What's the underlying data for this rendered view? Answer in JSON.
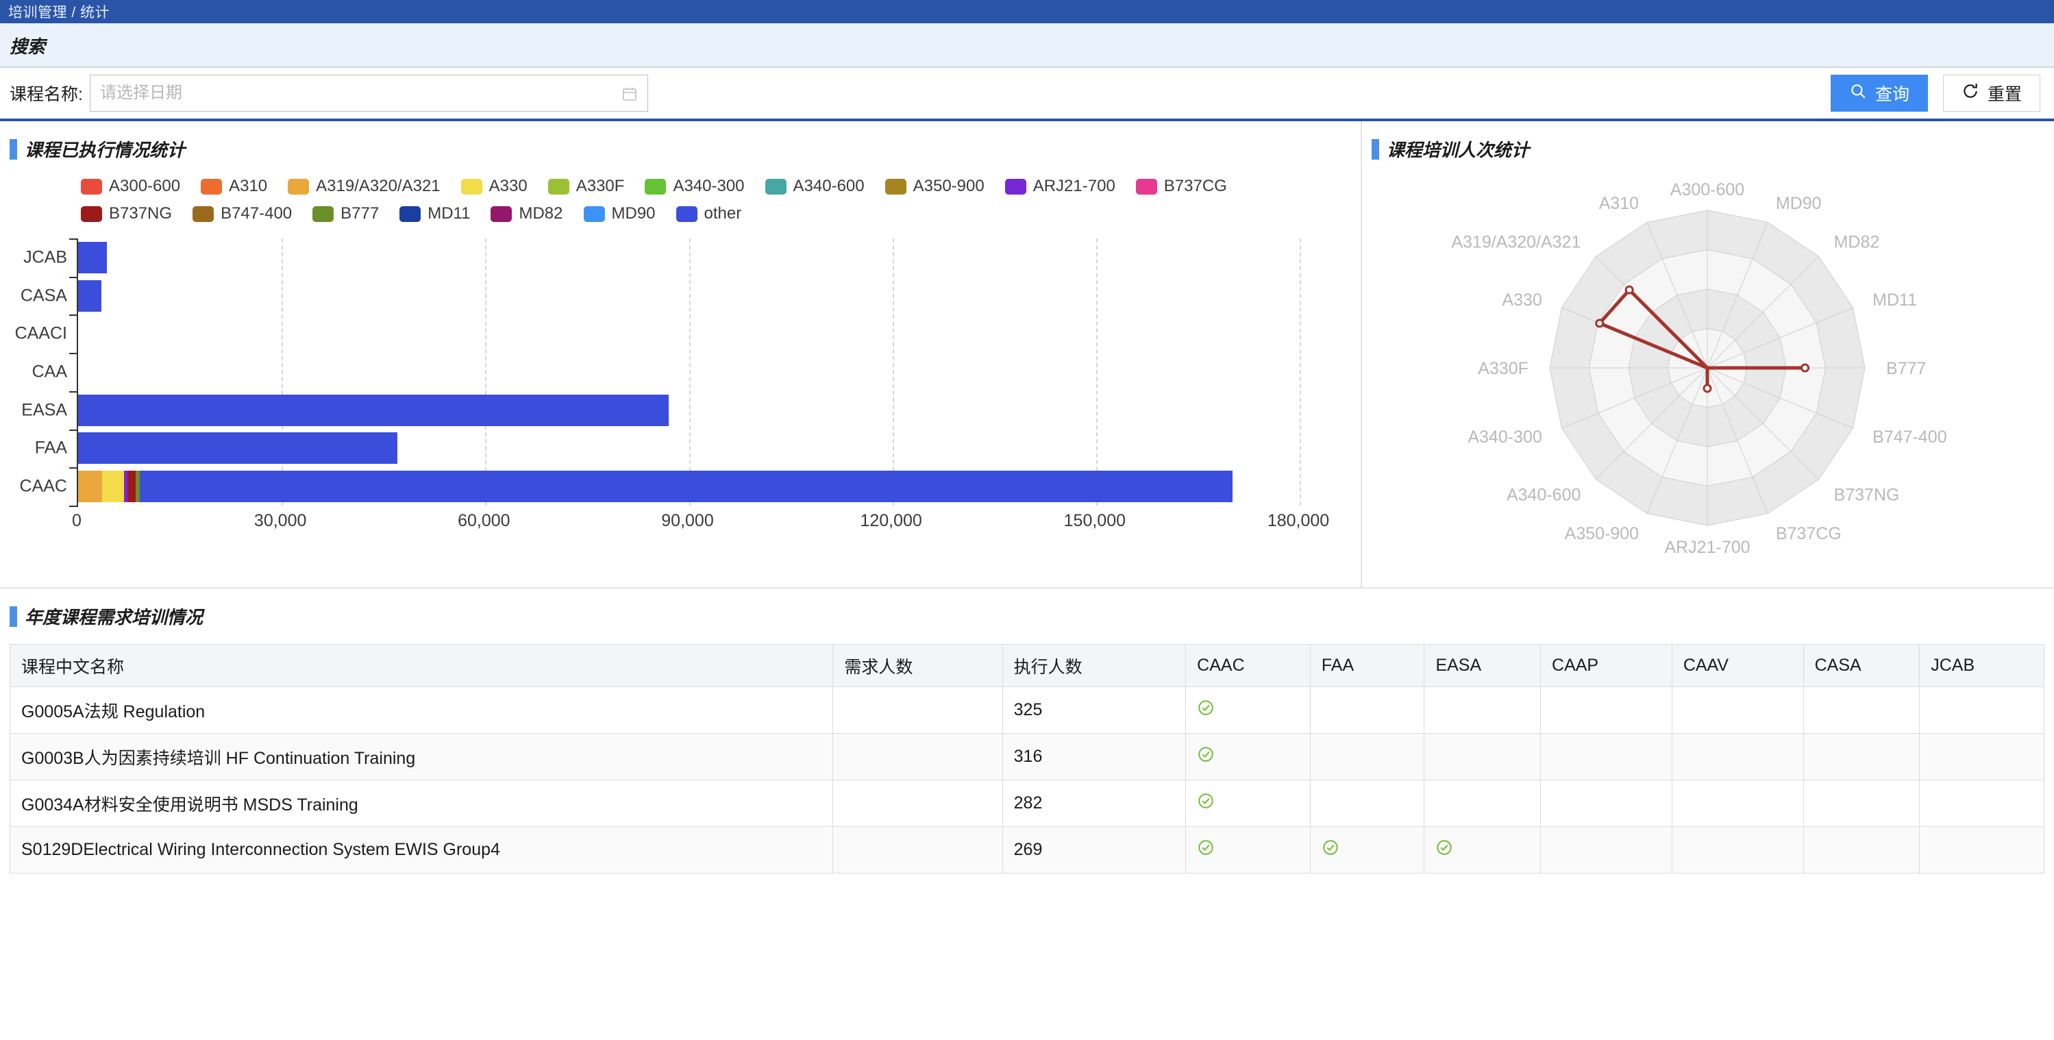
{
  "breadcrumb": {
    "text": "培训管理 / 统计"
  },
  "search": {
    "title": "搜索",
    "field_label": "课程名称:",
    "date_value": "",
    "date_placeholder": "请选择日期",
    "calendar_icon": "calendar-icon",
    "query_button": "查询",
    "query_icon": "search-icon",
    "reset_button": "重置",
    "reset_icon": "refresh-icon"
  },
  "panels": {
    "bar_title": "课程已执行情况统计",
    "radar_title": "课程培训人次统计",
    "table_title": "年度课程需求培训情况"
  },
  "colors": {
    "brand_blue": "#2a54a8",
    "accent_blue": "#4a90e8",
    "primary_button": "#3d8bf2",
    "radar_line": "#a5342c",
    "check_green": "#6ebe2f"
  },
  "chart_data": [
    {
      "type": "bar",
      "title": "课程已执行情况统计",
      "orientation": "horizontal",
      "stacked": true,
      "xlabel": "",
      "ylabel": "",
      "xlim": [
        0,
        180000
      ],
      "grid": true,
      "legend_position": "top",
      "xticks": [
        "0",
        "30,000",
        "60,000",
        "90,000",
        "120,000",
        "150,000",
        "180,000"
      ],
      "xtick_values": [
        0,
        30000,
        60000,
        90000,
        120000,
        150000,
        180000
      ],
      "categories": [
        "CAAC",
        "FAA",
        "EASA",
        "CAA",
        "CAACI",
        "CASA",
        "JCAB"
      ],
      "series": [
        {
          "name": "A300-600",
          "color": "#e84c3d",
          "values": [
            0,
            0,
            0,
            0,
            0,
            0,
            0
          ]
        },
        {
          "name": "A310",
          "color": "#ed6c30",
          "values": [
            0,
            0,
            0,
            0,
            0,
            0,
            0
          ]
        },
        {
          "name": "A319/A320/A321",
          "color": "#eaa73c",
          "values": [
            3500,
            0,
            0,
            0,
            0,
            0,
            0
          ]
        },
        {
          "name": "A330",
          "color": "#f3dc4a",
          "values": [
            3300,
            0,
            0,
            0,
            0,
            0,
            0
          ]
        },
        {
          "name": "A330F",
          "color": "#9cc034",
          "values": [
            0,
            0,
            0,
            0,
            0,
            0,
            0
          ]
        },
        {
          "name": "A340-300",
          "color": "#66c235",
          "values": [
            0,
            0,
            0,
            0,
            0,
            0,
            0
          ]
        },
        {
          "name": "A340-600",
          "color": "#45a8a4",
          "values": [
            0,
            0,
            0,
            0,
            0,
            0,
            0
          ]
        },
        {
          "name": "A350-900",
          "color": "#a68520",
          "values": [
            0,
            0,
            0,
            0,
            0,
            0,
            0
          ]
        },
        {
          "name": "ARJ21-700",
          "color": "#7726d8",
          "values": [
            500,
            0,
            0,
            0,
            0,
            0,
            0
          ]
        },
        {
          "name": "B737CG",
          "color": "#e8388f",
          "values": [
            0,
            0,
            0,
            0,
            0,
            0,
            0
          ]
        },
        {
          "name": "B737NG",
          "color": "#9c1a1a",
          "values": [
            1200,
            0,
            0,
            0,
            0,
            0,
            0
          ]
        },
        {
          "name": "B747-400",
          "color": "#9a6a1c",
          "values": [
            0,
            0,
            0,
            0,
            0,
            0,
            0
          ]
        },
        {
          "name": "B777",
          "color": "#6a8f28",
          "values": [
            600,
            0,
            0,
            0,
            0,
            0,
            0
          ]
        },
        {
          "name": "MD11",
          "color": "#1a3fa0",
          "values": [
            0,
            0,
            0,
            0,
            0,
            0,
            0
          ]
        },
        {
          "name": "MD82",
          "color": "#93176d",
          "values": [
            0,
            0,
            0,
            0,
            0,
            0,
            0
          ]
        },
        {
          "name": "MD90",
          "color": "#3d92f5",
          "values": [
            0,
            0,
            0,
            0,
            0,
            0,
            0
          ]
        },
        {
          "name": "other",
          "color": "#3b4ddb",
          "values": [
            161000,
            47000,
            87000,
            0,
            0,
            3400,
            4200
          ]
        }
      ]
    },
    {
      "type": "radar",
      "title": "课程培训人次统计",
      "axes": [
        "A300-600",
        "MD90",
        "MD82",
        "MD11",
        "B777",
        "B747-400",
        "B737NG",
        "B737CG",
        "ARJ21-700",
        "A350-900",
        "A340-600",
        "A340-300",
        "A330F",
        "A330",
        "A319/A320/A321",
        "A310"
      ],
      "rings": 4,
      "max": 100,
      "series": [
        {
          "name": "培训人次",
          "color": "#a5342c",
          "values": [
            0,
            0,
            0,
            0,
            62,
            0,
            0,
            0,
            13,
            0,
            0,
            0,
            0,
            74,
            70,
            0
          ]
        }
      ]
    }
  ],
  "table": {
    "columns": [
      "课程中文名称",
      "需求人数",
      "执行人数",
      "CAAC",
      "FAA",
      "EASA",
      "CAAP",
      "CAAV",
      "CASA",
      "JCAB"
    ],
    "rows": [
      {
        "name": "G0005A法规 Regulation",
        "demand": "",
        "executed": "325",
        "caac": true,
        "faa": false,
        "easa": false,
        "caap": false,
        "caav": false,
        "casa": false,
        "jcab": false
      },
      {
        "name": "G0003B人为因素持续培训 HF Continuation Training",
        "demand": "",
        "executed": "316",
        "caac": true,
        "faa": false,
        "easa": false,
        "caap": false,
        "caav": false,
        "casa": false,
        "jcab": false
      },
      {
        "name": "G0034A材料安全使用说明书 MSDS Training",
        "demand": "",
        "executed": "282",
        "caac": true,
        "faa": false,
        "easa": false,
        "caap": false,
        "caav": false,
        "casa": false,
        "jcab": false
      },
      {
        "name": "S0129DElectrical Wiring Interconnection System EWIS Group4",
        "demand": "",
        "executed": "269",
        "caac": true,
        "faa": true,
        "easa": true,
        "caap": false,
        "caav": false,
        "casa": false,
        "jcab": false
      }
    ],
    "check_glyph": "✓"
  }
}
